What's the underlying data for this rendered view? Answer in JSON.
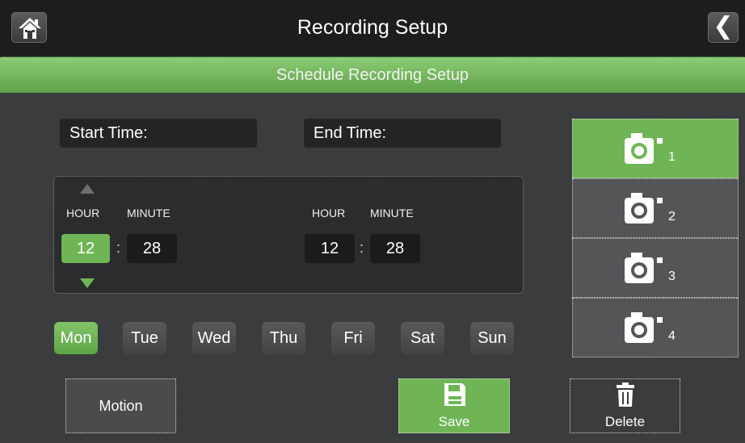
{
  "header": {
    "title": "Recording Setup",
    "back_label": "❮"
  },
  "subheader": {
    "title": "Schedule Recording Setup"
  },
  "schedule": {
    "start_label": "Start Time:",
    "end_label": "End Time:",
    "start": {
      "hour_label": "HOUR",
      "minute_label": "MINUTE",
      "hour": "12",
      "minute": "28",
      "separator": ":"
    },
    "end": {
      "hour_label": "HOUR",
      "minute_label": "MINUTE",
      "hour": "12",
      "minute": "28",
      "separator": ":"
    }
  },
  "days": [
    {
      "label": "Mon",
      "selected": true
    },
    {
      "label": "Tue",
      "selected": false
    },
    {
      "label": "Wed",
      "selected": false
    },
    {
      "label": "Thu",
      "selected": false
    },
    {
      "label": "Fri",
      "selected": false
    },
    {
      "label": "Sat",
      "selected": false
    },
    {
      "label": "Sun",
      "selected": false
    }
  ],
  "actions": {
    "motion_label": "Motion",
    "save_label": "Save",
    "delete_label": "Delete"
  },
  "cameras": [
    {
      "number": "1",
      "selected": true
    },
    {
      "number": "2",
      "selected": false
    },
    {
      "number": "3",
      "selected": false
    },
    {
      "number": "4",
      "selected": false
    }
  ],
  "colors": {
    "accent_green": "#6fb556",
    "background": "#3b3c3e",
    "header_bg": "#1d1d1e"
  },
  "icons": {
    "home": "home-icon",
    "back": "chevron-left-icon",
    "camera": "camera-icon",
    "save": "floppy-disk-icon",
    "delete": "trash-icon",
    "increase": "arrow-up-icon",
    "decrease": "arrow-down-icon"
  }
}
